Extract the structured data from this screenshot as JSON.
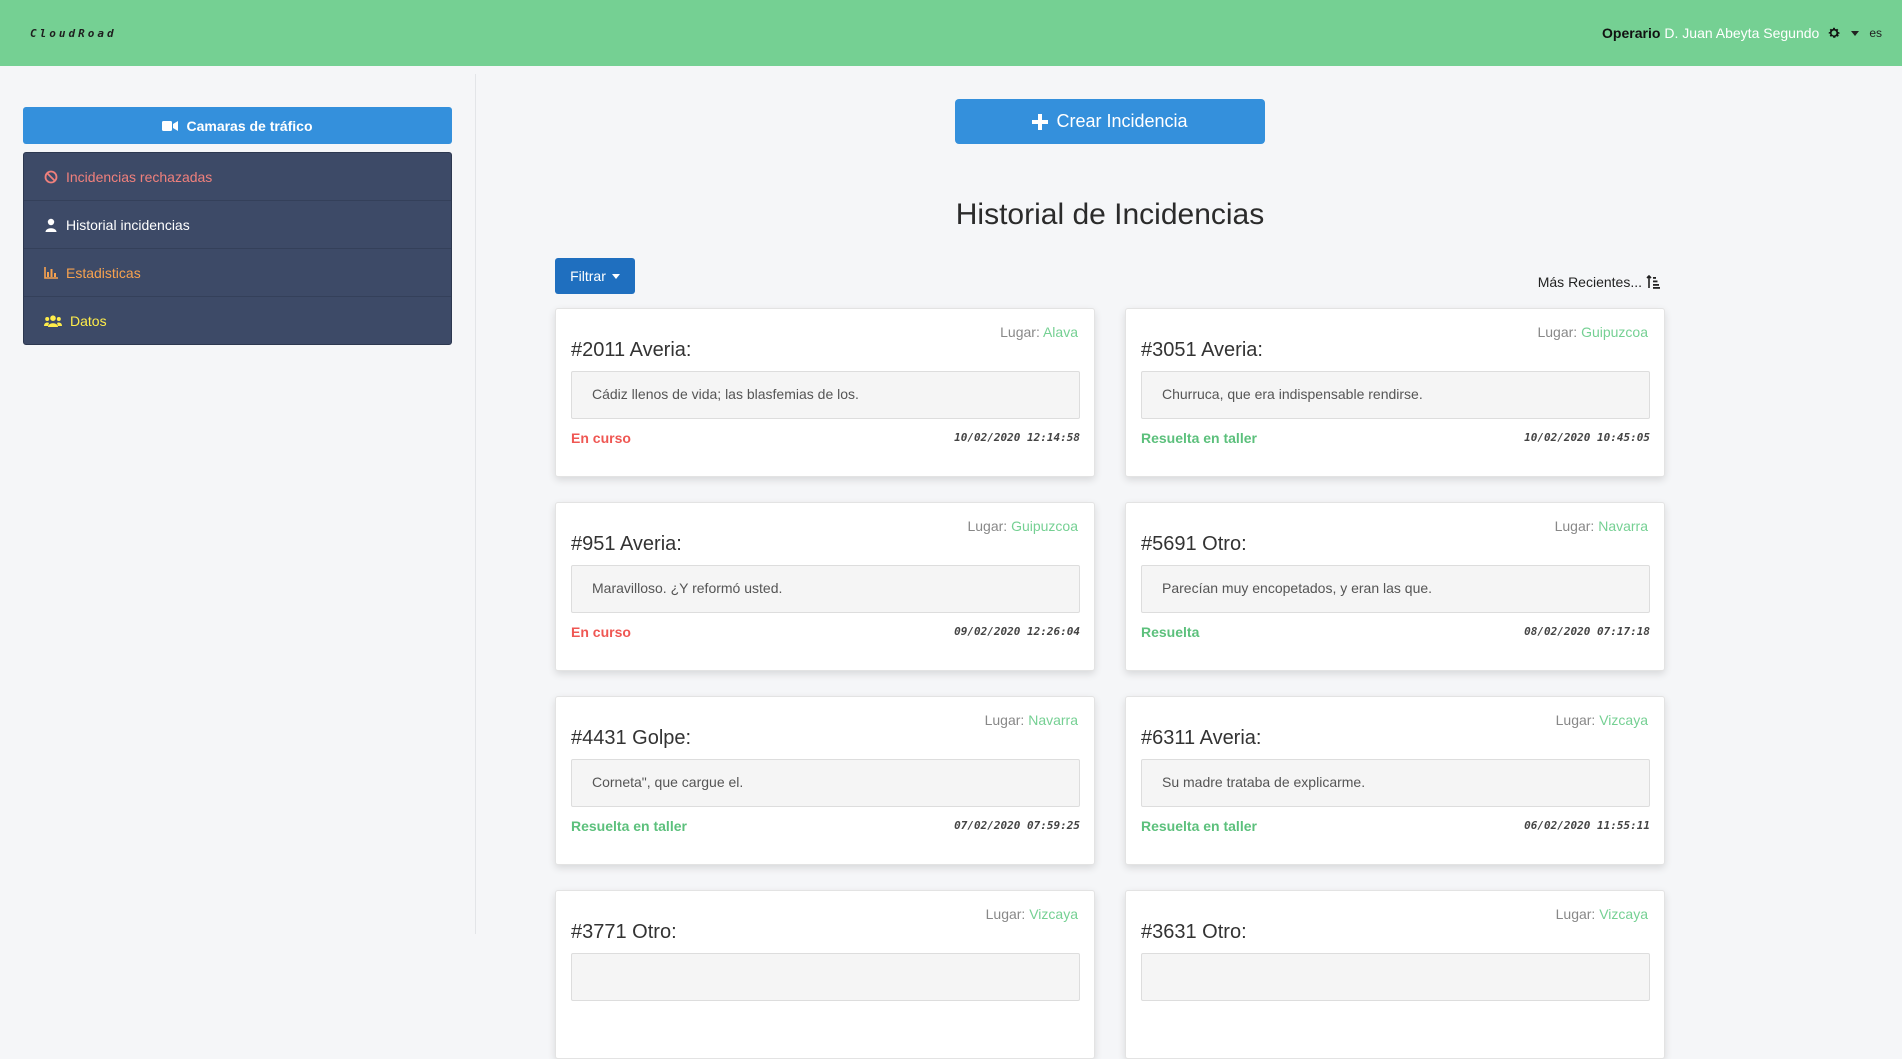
{
  "navbar": {
    "brand": "CloudRoad",
    "user_role": "Operario",
    "user_name": "D. Juan Abeyta Segundo",
    "language": "es"
  },
  "sidebar": {
    "camera_button": "Camaras de tráfico",
    "items": [
      {
        "label": "Incidencias rechazadas",
        "icon": "ban-icon",
        "color": "#f0807c"
      },
      {
        "label": "Historial incidencias",
        "icon": "user-icon",
        "color": "#ffffff"
      },
      {
        "label": "Estadisticas",
        "icon": "chart-icon",
        "color": "#f7a24f"
      },
      {
        "label": "Datos",
        "icon": "users-icon",
        "color": "#ffed4a"
      }
    ]
  },
  "main": {
    "create_button": "Crear Incidencia",
    "title": "Historial de Incidencias",
    "filter_button": "Filtrar",
    "sort_label": "Más Recientes..."
  },
  "lugar_label": "Lugar:",
  "incidents": [
    {
      "title": "#2011 Averia:",
      "place": "Alava",
      "description": "Cádiz llenos de vida; las blasfemias de los.",
      "status": "En curso",
      "status_color": "#ef5753",
      "date": "10/02/2020 12:14:58"
    },
    {
      "title": "#3051 Averia:",
      "place": "Guipuzcoa",
      "description": "Churruca, que era indispensable rendirse.",
      "status": "Resuelta en taller",
      "status_color": "#5cc07c",
      "date": "10/02/2020 10:45:05"
    },
    {
      "title": "#951 Averia:",
      "place": "Guipuzcoa",
      "description": "Maravilloso. ¿Y reformó usted.",
      "status": "En curso",
      "status_color": "#ef5753",
      "date": "09/02/2020 12:26:04"
    },
    {
      "title": "#5691 Otro:",
      "place": "Navarra",
      "description": "Parecían muy encopetados, y eran las que.",
      "status": "Resuelta",
      "status_color": "#5cc07c",
      "date": "08/02/2020 07:17:18"
    },
    {
      "title": "#4431 Golpe:",
      "place": "Navarra",
      "description": "Corneta\", que cargue el.",
      "status": "Resuelta en taller",
      "status_color": "#5cc07c",
      "date": "07/02/2020 07:59:25"
    },
    {
      "title": "#6311 Averia:",
      "place": "Vizcaya",
      "description": "Su madre trataba de explicarme.",
      "status": "Resuelta en taller",
      "status_color": "#5cc07c",
      "date": "06/02/2020 11:55:11"
    },
    {
      "title": "#3771 Otro:",
      "place": "Vizcaya",
      "description": "",
      "status": "",
      "status_color": "#5cc07c",
      "date": ""
    },
    {
      "title": "#3631 Otro:",
      "place": "Vizcaya",
      "description": "",
      "status": "",
      "status_color": "#5cc07c",
      "date": ""
    }
  ]
}
